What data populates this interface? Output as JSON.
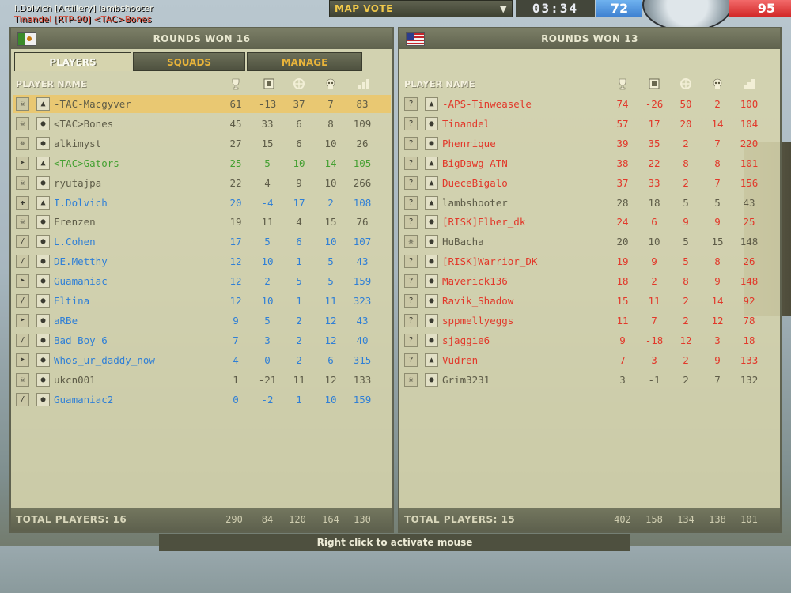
{
  "hud": {
    "killfeed_line1": "I.Dolvich [Artillery] lambshooter",
    "killfeed_line2": "Tinandel [RTP-90] <TAC>Bones",
    "map_vote": "MAP VOTE",
    "timer": "03:34",
    "us_tickets": "72",
    "mec_tickets": "95"
  },
  "left_team": {
    "rounds_won": "ROUNDS WON 16",
    "tabs": [
      "PLAYERS",
      "SQUADS",
      "MANAGE"
    ],
    "header_label": "PLAYER NAME",
    "players": [
      {
        "kit": "☠",
        "rank": "▲",
        "name": "-TAC-Macgyver",
        "score": "61",
        "team": "-13",
        "kills": "37",
        "deaths": "7",
        "ping": "83",
        "color": "gray",
        "highlight": true
      },
      {
        "kit": "☠",
        "rank": "●",
        "name": "<TAC>Bones",
        "score": "45",
        "team": "33",
        "kills": "6",
        "deaths": "8",
        "ping": "109",
        "color": "gray"
      },
      {
        "kit": "☠",
        "rank": "●",
        "name": "alkimyst",
        "score": "27",
        "team": "15",
        "kills": "6",
        "deaths": "10",
        "ping": "26",
        "color": "gray"
      },
      {
        "kit": "➤",
        "rank": "▲",
        "name": "<TAC>Gators",
        "score": "25",
        "team": "5",
        "kills": "10",
        "deaths": "14",
        "ping": "105",
        "color": "green"
      },
      {
        "kit": "☠",
        "rank": "●",
        "name": "ryutajpa",
        "score": "22",
        "team": "4",
        "kills": "9",
        "deaths": "10",
        "ping": "266",
        "color": "gray"
      },
      {
        "kit": "✚",
        "rank": "▲",
        "name": "I.Dolvich",
        "score": "20",
        "team": "-4",
        "kills": "17",
        "deaths": "2",
        "ping": "108",
        "color": "blue"
      },
      {
        "kit": "☠",
        "rank": "●",
        "name": "Frenzen",
        "score": "19",
        "team": "11",
        "kills": "4",
        "deaths": "15",
        "ping": "76",
        "color": "gray"
      },
      {
        "kit": "/",
        "rank": "●",
        "name": "L.Cohen",
        "score": "17",
        "team": "5",
        "kills": "6",
        "deaths": "10",
        "ping": "107",
        "color": "blue"
      },
      {
        "kit": "/",
        "rank": "●",
        "name": "DE.Metthy",
        "score": "12",
        "team": "10",
        "kills": "1",
        "deaths": "5",
        "ping": "43",
        "color": "blue"
      },
      {
        "kit": "➤",
        "rank": "●",
        "name": "Guamaniac",
        "score": "12",
        "team": "2",
        "kills": "5",
        "deaths": "5",
        "ping": "159",
        "color": "blue"
      },
      {
        "kit": "/",
        "rank": "●",
        "name": "Eltina",
        "score": "12",
        "team": "10",
        "kills": "1",
        "deaths": "11",
        "ping": "323",
        "color": "blue"
      },
      {
        "kit": "➤",
        "rank": "●",
        "name": "aRBe",
        "score": "9",
        "team": "5",
        "kills": "2",
        "deaths": "12",
        "ping": "43",
        "color": "blue"
      },
      {
        "kit": "/",
        "rank": "●",
        "name": "Bad_Boy_6",
        "score": "7",
        "team": "3",
        "kills": "2",
        "deaths": "12",
        "ping": "40",
        "color": "blue"
      },
      {
        "kit": "➤",
        "rank": "●",
        "name": "Whos_ur_daddy_now",
        "score": "4",
        "team": "0",
        "kills": "2",
        "deaths": "6",
        "ping": "315",
        "color": "blue"
      },
      {
        "kit": "☠",
        "rank": "●",
        "name": "ukcn001",
        "score": "1",
        "team": "-21",
        "kills": "11",
        "deaths": "12",
        "ping": "133",
        "color": "gray"
      },
      {
        "kit": "/",
        "rank": "●",
        "name": "Guamaniac2",
        "score": "0",
        "team": "-2",
        "kills": "1",
        "deaths": "10",
        "ping": "159",
        "color": "blue"
      }
    ],
    "total_label": "TOTAL PLAYERS: 16",
    "totals": [
      "290",
      "84",
      "120",
      "164",
      "130"
    ]
  },
  "right_team": {
    "rounds_won": "ROUNDS WON 13",
    "header_label": "PLAYER NAME",
    "players": [
      {
        "kit": "?",
        "rank": "▲",
        "name": "-APS-Tinweasele",
        "score": "74",
        "team": "-26",
        "kills": "50",
        "deaths": "2",
        "ping": "100",
        "color": "red"
      },
      {
        "kit": "?",
        "rank": "●",
        "name": "Tinandel",
        "score": "57",
        "team": "17",
        "kills": "20",
        "deaths": "14",
        "ping": "104",
        "color": "red"
      },
      {
        "kit": "?",
        "rank": "●",
        "name": "Phenrique",
        "score": "39",
        "team": "35",
        "kills": "2",
        "deaths": "7",
        "ping": "220",
        "color": "red"
      },
      {
        "kit": "?",
        "rank": "▲",
        "name": "BigDawg-ATN",
        "score": "38",
        "team": "22",
        "kills": "8",
        "deaths": "8",
        "ping": "101",
        "color": "red"
      },
      {
        "kit": "?",
        "rank": "▲",
        "name": "DueceBigalo",
        "score": "37",
        "team": "33",
        "kills": "2",
        "deaths": "7",
        "ping": "156",
        "color": "red"
      },
      {
        "kit": "?",
        "rank": "▲",
        "name": "lambshooter",
        "score": "28",
        "team": "18",
        "kills": "5",
        "deaths": "5",
        "ping": "43",
        "color": "gray"
      },
      {
        "kit": "?",
        "rank": "●",
        "name": "[RISK]Elber_dk",
        "score": "24",
        "team": "6",
        "kills": "9",
        "deaths": "9",
        "ping": "25",
        "color": "red"
      },
      {
        "kit": "☠",
        "rank": "●",
        "name": "HuBacha",
        "score": "20",
        "team": "10",
        "kills": "5",
        "deaths": "15",
        "ping": "148",
        "color": "gray"
      },
      {
        "kit": "?",
        "rank": "●",
        "name": "[RISK]Warrior_DK",
        "score": "19",
        "team": "9",
        "kills": "5",
        "deaths": "8",
        "ping": "26",
        "color": "red"
      },
      {
        "kit": "?",
        "rank": "●",
        "name": "Maverick136",
        "score": "18",
        "team": "2",
        "kills": "8",
        "deaths": "9",
        "ping": "148",
        "color": "red"
      },
      {
        "kit": "?",
        "rank": "●",
        "name": "Ravik_Shadow",
        "score": "15",
        "team": "11",
        "kills": "2",
        "deaths": "14",
        "ping": "92",
        "color": "red"
      },
      {
        "kit": "?",
        "rank": "●",
        "name": "sppmellyeggs",
        "score": "11",
        "team": "7",
        "kills": "2",
        "deaths": "12",
        "ping": "78",
        "color": "red"
      },
      {
        "kit": "?",
        "rank": "●",
        "name": "sjaggie6",
        "score": "9",
        "team": "-18",
        "kills": "12",
        "deaths": "3",
        "ping": "18",
        "color": "red"
      },
      {
        "kit": "?",
        "rank": "▲",
        "name": "Vudren",
        "score": "7",
        "team": "3",
        "kills": "2",
        "deaths": "9",
        "ping": "133",
        "color": "red"
      },
      {
        "kit": "☠",
        "rank": "●",
        "name": "Grim3231",
        "score": "3",
        "team": "-1",
        "kills": "2",
        "deaths": "7",
        "ping": "132",
        "color": "gray"
      }
    ],
    "total_label": "TOTAL PLAYERS: 15",
    "totals": [
      "402",
      "158",
      "134",
      "138",
      "101"
    ]
  },
  "column_icons": [
    "trophy-icon",
    "teamwork-icon",
    "crosshair-kills-icon",
    "skull-deaths-icon",
    "ping-bars-icon"
  ],
  "hint": "Right click to activate mouse"
}
